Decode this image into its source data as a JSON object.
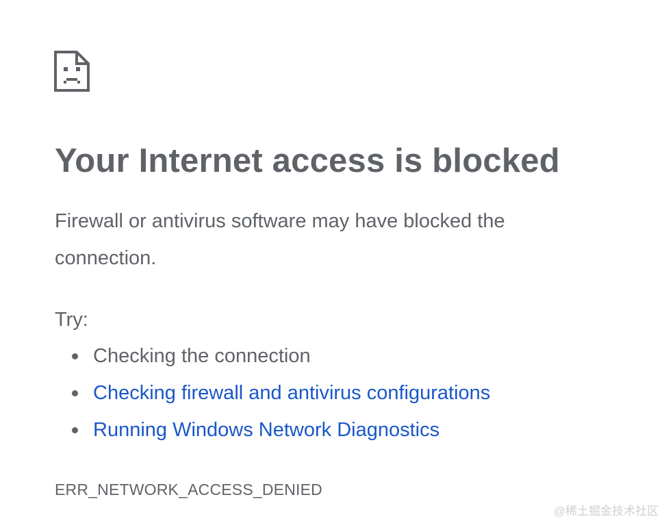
{
  "page": {
    "icon": "sad-page-icon",
    "title": "Your Internet access is blocked",
    "description": "Firewall or antivirus software may have blocked the connection.",
    "try_label": "Try:",
    "suggestions": [
      {
        "text": "Checking the connection",
        "is_link": false
      },
      {
        "text": "Checking firewall and antivirus configurations",
        "is_link": true
      },
      {
        "text": "Running Windows Network Diagnostics",
        "is_link": true
      }
    ],
    "error_code": "ERR_NETWORK_ACCESS_DENIED"
  },
  "watermark": {
    "text": "@稀土掘金技术社区"
  },
  "colors": {
    "text": "#5f6368",
    "link": "#1a57c9",
    "background": "#ffffff",
    "watermark": "#cfcfcf"
  }
}
